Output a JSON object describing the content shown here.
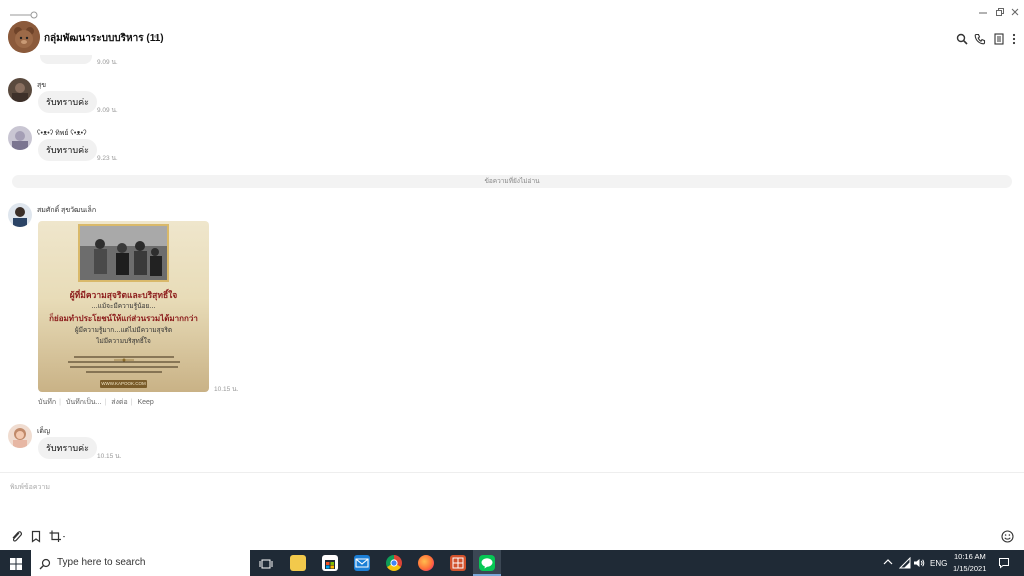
{
  "window": {
    "title": "กลุ่มพัฒนาระบบบริหาร (11)"
  },
  "header": {
    "group_name": "กลุ่มพัฒนาระบบบริหาร (11)"
  },
  "messages": [
    {
      "sender": "สุข",
      "text": "รับทราบค่ะ",
      "time": "9.09 น."
    },
    {
      "sender": "ʕ•ᴥ•ʔ ทิพย์ ʕ•ᴥ•ʔ",
      "text": "รับทราบค่ะ",
      "time": "9.23 น."
    },
    {
      "sender": "เต็ญ",
      "text": "รับทราบค่ะ",
      "time": "10.15 น."
    }
  ],
  "partial_time": "9.09 น.",
  "divider": {
    "label": "ข้อความที่ยังไม่อ่าน"
  },
  "image_message": {
    "sender": "สมศักดิ์ สุขวัฒนเล็ก",
    "time": "10.15 น.",
    "poster": {
      "line1": "ผู้ที่มีความสุจริตและบริสุทธิ์ใจ",
      "line2": "...แม้จะมีความรู้น้อย...",
      "line3": "ก็ย่อมทำประโยชน์ให้แก่ส่วนรวมได้มากกว่า",
      "line4": "ผู้มีความรู้มาก...แต่ไม่มีความสุจริต",
      "line5": "ไม่มีความบริสุทธิ์ใจ",
      "footer": "WWW.KAPOOK.COM"
    },
    "actions": [
      "บันทึก",
      "บันทึกเป็น...",
      "ส่งต่อ",
      "Keep"
    ]
  },
  "input": {
    "placeholder": "พิมพ์ข้อความ"
  },
  "taskbar": {
    "search_placeholder": "Type here to search",
    "language": "ENG",
    "time": "10:16 AM",
    "date": "1/15/2021"
  },
  "colors": {
    "taskbar_bg": "#1f2a36",
    "line_green": "#06c755",
    "bubble_bg": "#f1f1f1"
  }
}
